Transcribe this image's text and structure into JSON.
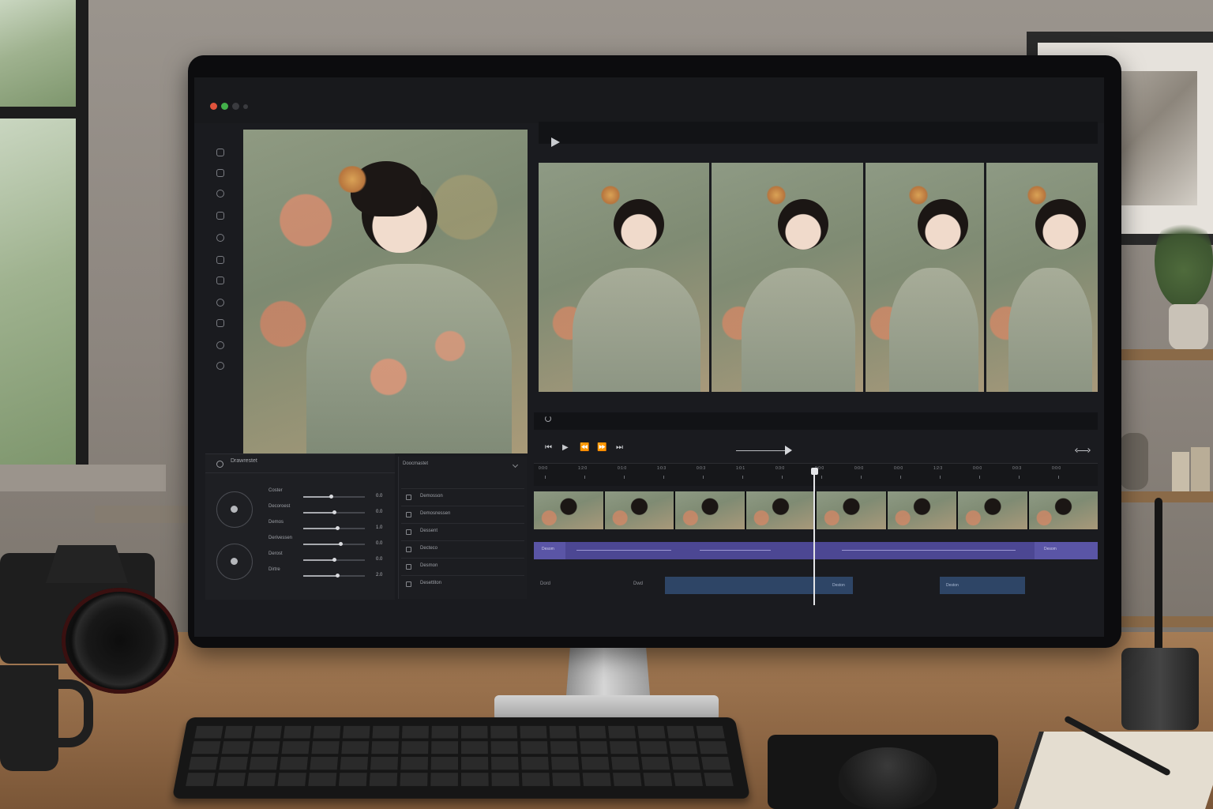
{
  "editor": {
    "left_panel_title": "Drawrestet",
    "sliders": [
      {
        "label": "Coster",
        "value": "0.0",
        "level": 0.45
      },
      {
        "label": "Decoroest",
        "value": "0.0",
        "level": 0.5
      },
      {
        "label": "Demos",
        "value": "1.0",
        "level": 0.55
      },
      {
        "label": "Derivessen",
        "value": "0.0",
        "level": 0.6
      },
      {
        "label": "Derost",
        "value": "0.0",
        "level": 0.5
      },
      {
        "label": "Dirtre",
        "value": "2.0",
        "level": 0.55
      }
    ],
    "mid_panel_title": "Doocmastet",
    "layers": [
      "Demosson",
      "Demosnessen",
      "Dessent",
      "Decteco",
      "Desmon",
      "Desettiton"
    ],
    "ruler_labels": [
      "0:0:0",
      "1:2:0",
      "0:1:0",
      "1:0:3",
      "0:0:3",
      "1:0:1",
      "0:3:0",
      "0:0:0",
      "0:0:0",
      "0:0:0",
      "1:2:3",
      "0:0:0",
      "0:0:3",
      "0:0:0"
    ],
    "track_labels": {
      "purple_start": "Desom",
      "purple_end": "Desom",
      "audio_left": "Dord",
      "audio_mid": "Dwd",
      "clip1": "Deston",
      "clip2": "Deston"
    }
  },
  "icons": {
    "window_controls": [
      "close-dot",
      "zoom-dot",
      "disabled-dot"
    ],
    "transport": [
      "skip-back-icon",
      "play-icon",
      "step-back-icon",
      "step-forward-icon",
      "skip-end-icon"
    ]
  },
  "colors": {
    "screen_bg": "#1a1b1f",
    "track_purple": "#4c4793",
    "track_blue": "#2e4566",
    "playhead": "#e4e5e8"
  },
  "timeline": {
    "playhead_fraction": 0.5
  }
}
